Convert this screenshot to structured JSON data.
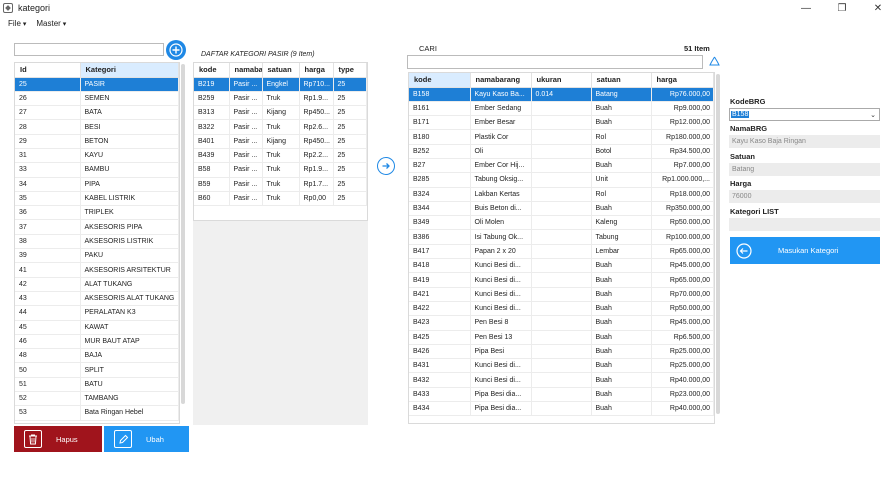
{
  "window": {
    "title": "kategori"
  },
  "menu": {
    "file": "File",
    "master": "Master"
  },
  "left": {
    "columns": [
      "Id",
      "Kategori"
    ],
    "rows": [
      [
        "25",
        "PASIR"
      ],
      [
        "26",
        "SEMEN"
      ],
      [
        "27",
        "BATA"
      ],
      [
        "28",
        "BESI"
      ],
      [
        "29",
        "BETON"
      ],
      [
        "31",
        "KAYU"
      ],
      [
        "33",
        "BAMBU"
      ],
      [
        "34",
        "PIPA"
      ],
      [
        "35",
        "KABEL LISTRIK"
      ],
      [
        "36",
        "TRIPLEK"
      ],
      [
        "37",
        "AKSESORIS PIPA"
      ],
      [
        "38",
        "AKSESORIS LISTRIK"
      ],
      [
        "39",
        "PAKU"
      ],
      [
        "41",
        "AKSESORIS ARSITEKTUR"
      ],
      [
        "42",
        "ALAT TUKANG"
      ],
      [
        "43",
        "AKSESORIS ALAT TUKANG"
      ],
      [
        "44",
        "PERALATAN K3"
      ],
      [
        "45",
        "KAWAT"
      ],
      [
        "46",
        "MUR BAUT ATAP"
      ],
      [
        "48",
        "BAJA"
      ],
      [
        "50",
        "SPLIT"
      ],
      [
        "51",
        "BATU"
      ],
      [
        "52",
        "TAMBANG"
      ],
      [
        "53",
        "Bata Ringan Hebel"
      ]
    ],
    "selected_index": 0,
    "btn_hapus": "Hapus",
    "btn_ubah": "Ubah"
  },
  "middle": {
    "heading": "DAFTAR KATEGORI PASIR (9 Item)",
    "columns": [
      "kode",
      "namaba",
      "satuan",
      "harga",
      "type"
    ],
    "rows": [
      [
        "B219",
        "Pasir ...",
        "Engkel",
        "Rp710...",
        "25"
      ],
      [
        "B259",
        "Pasir ...",
        "Truk",
        "Rp1.9...",
        "25"
      ],
      [
        "B313",
        "Pasir ...",
        "Kijang",
        "Rp450...",
        "25"
      ],
      [
        "B322",
        "Pasir ...",
        "Truk",
        "Rp2.6...",
        "25"
      ],
      [
        "B401",
        "Pasir ...",
        "Kijang",
        "Rp450...",
        "25"
      ],
      [
        "B439",
        "Pasir ...",
        "Truk",
        "Rp2.2...",
        "25"
      ],
      [
        "B58",
        "Pasir ...",
        "Truk",
        "Rp1.9...",
        "25"
      ],
      [
        "B59",
        "Pasir ...",
        "Truk",
        "Rp1.7...",
        "25"
      ],
      [
        "B60",
        "Pasir ...",
        "Truk",
        "Rp0,00",
        "25"
      ]
    ],
    "selected_index": 0
  },
  "right": {
    "cari_label": "CARI",
    "count": "51 Item",
    "search_value": "",
    "columns": [
      "kode",
      "namabarang",
      "ukuran",
      "satuan",
      "harga"
    ],
    "rows": [
      [
        "B158",
        "Kayu Kaso Ba...",
        "0.014",
        "Batang",
        "Rp76.000,00"
      ],
      [
        "B161",
        "Ember Sedang",
        "",
        "Buah",
        "Rp9.000,00"
      ],
      [
        "B171",
        "Ember Besar",
        "",
        "Buah",
        "Rp12.000,00"
      ],
      [
        "B180",
        "Plastik Cor",
        "",
        "Rol",
        "Rp180.000,00"
      ],
      [
        "B252",
        "Oli",
        "",
        "Botol",
        "Rp34.500,00"
      ],
      [
        "B27",
        "Ember Cor Hij...",
        "",
        "Buah",
        "Rp7.000,00"
      ],
      [
        "B285",
        "Tabung Oksig...",
        "",
        "Unit",
        "Rp1.000.000,..."
      ],
      [
        "B324",
        "Lakban Kertas",
        "",
        "Rol",
        "Rp18.000,00"
      ],
      [
        "B344",
        "Buis Beton di...",
        "",
        "Buah",
        "Rp350.000,00"
      ],
      [
        "B349",
        "Oli Molen",
        "",
        "Kaleng",
        "Rp50.000,00"
      ],
      [
        "B386",
        "Isi Tabung Ok...",
        "",
        "Tabung",
        "Rp100.000,00"
      ],
      [
        "B417",
        "Papan 2 x 20",
        "",
        "Lembar",
        "Rp65.000,00"
      ],
      [
        "B418",
        "Kunci Besi di...",
        "",
        "Buah",
        "Rp45.000,00"
      ],
      [
        "B419",
        "Kunci Besi di...",
        "",
        "Buah",
        "Rp65.000,00"
      ],
      [
        "B421",
        "Kunci Besi di...",
        "",
        "Buah",
        "Rp70.000,00"
      ],
      [
        "B422",
        "Kunci Besi di...",
        "",
        "Buah",
        "Rp50.000,00"
      ],
      [
        "B423",
        "Pen Besi 8",
        "",
        "Buah",
        "Rp45.000,00"
      ],
      [
        "B425",
        "Pen Besi 13",
        "",
        "Buah",
        "Rp6.500,00"
      ],
      [
        "B426",
        "Pipa Besi",
        "",
        "Buah",
        "Rp25.000,00"
      ],
      [
        "B431",
        "Kunci Besi di...",
        "",
        "Buah",
        "Rp25.000,00"
      ],
      [
        "B432",
        "Kunci Besi di...",
        "",
        "Buah",
        "Rp40.000,00"
      ],
      [
        "B433",
        "Pipa Besi dia...",
        "",
        "Buah",
        "Rp23.000,00"
      ],
      [
        "B434",
        "Pipa Besi dia...",
        "",
        "Buah",
        "Rp40.000,00"
      ]
    ],
    "selected_index": 0
  },
  "form": {
    "kode_label": "KodeBRG",
    "kode_value": "B158",
    "nama_label": "NamaBRG",
    "nama_value": "Kayu Kaso Baja Ringan",
    "satuan_label": "Satuan",
    "satuan_value": "Batang",
    "harga_label": "Harga",
    "harga_value": "76000",
    "kategori_label": "Kategori LIST",
    "kategori_value": "",
    "submit_label": "Masukan Kategori"
  },
  "colors": {
    "accent": "#1e7fd6",
    "danger": "#a0141c",
    "primary_button": "#2196f3"
  },
  "icons": {
    "add": "plus-circle-icon",
    "transfer": "arrow-right-circle-icon",
    "refresh": "recycle-icon",
    "delete": "trash-icon",
    "edit": "edit-icon",
    "back": "arrow-left-circle-icon"
  }
}
